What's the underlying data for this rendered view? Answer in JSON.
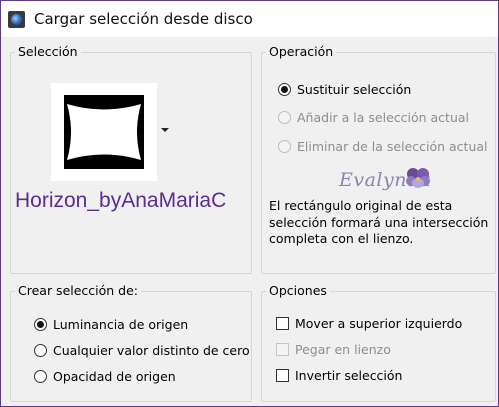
{
  "window": {
    "title": "Cargar selección desde disco",
    "icon": "camera-lens-icon"
  },
  "seleccion": {
    "legend": "Selección",
    "name": "Horizon_byAnaMariaC",
    "name_color": "#5b2d91",
    "dropdown_icon": "chevron-down-icon"
  },
  "operacion": {
    "legend": "Operación",
    "options": [
      {
        "label": "Sustituir selección",
        "checked": true,
        "enabled": true
      },
      {
        "label": "Añadir a la selección actual",
        "checked": false,
        "enabled": false
      },
      {
        "label": "Eliminar de la selección actual",
        "checked": false,
        "enabled": false
      }
    ],
    "watermark": "Evalynda",
    "description": "El rectángulo original de esta selección formará una intersección completa con el lienzo."
  },
  "crear": {
    "legend": "Crear selección de:",
    "options": [
      {
        "label": "Luminancia de origen",
        "checked": true
      },
      {
        "label": "Cualquier valor distinto de cero",
        "checked": false
      },
      {
        "label": "Opacidad de origen",
        "checked": false
      }
    ]
  },
  "opciones": {
    "legend": "Opciones",
    "options": [
      {
        "label": "Mover a superior izquierdo",
        "checked": false,
        "enabled": true
      },
      {
        "label": "Pegar en lienzo",
        "checked": false,
        "enabled": false
      },
      {
        "label": "Invertir selección",
        "checked": false,
        "enabled": true
      }
    ]
  }
}
